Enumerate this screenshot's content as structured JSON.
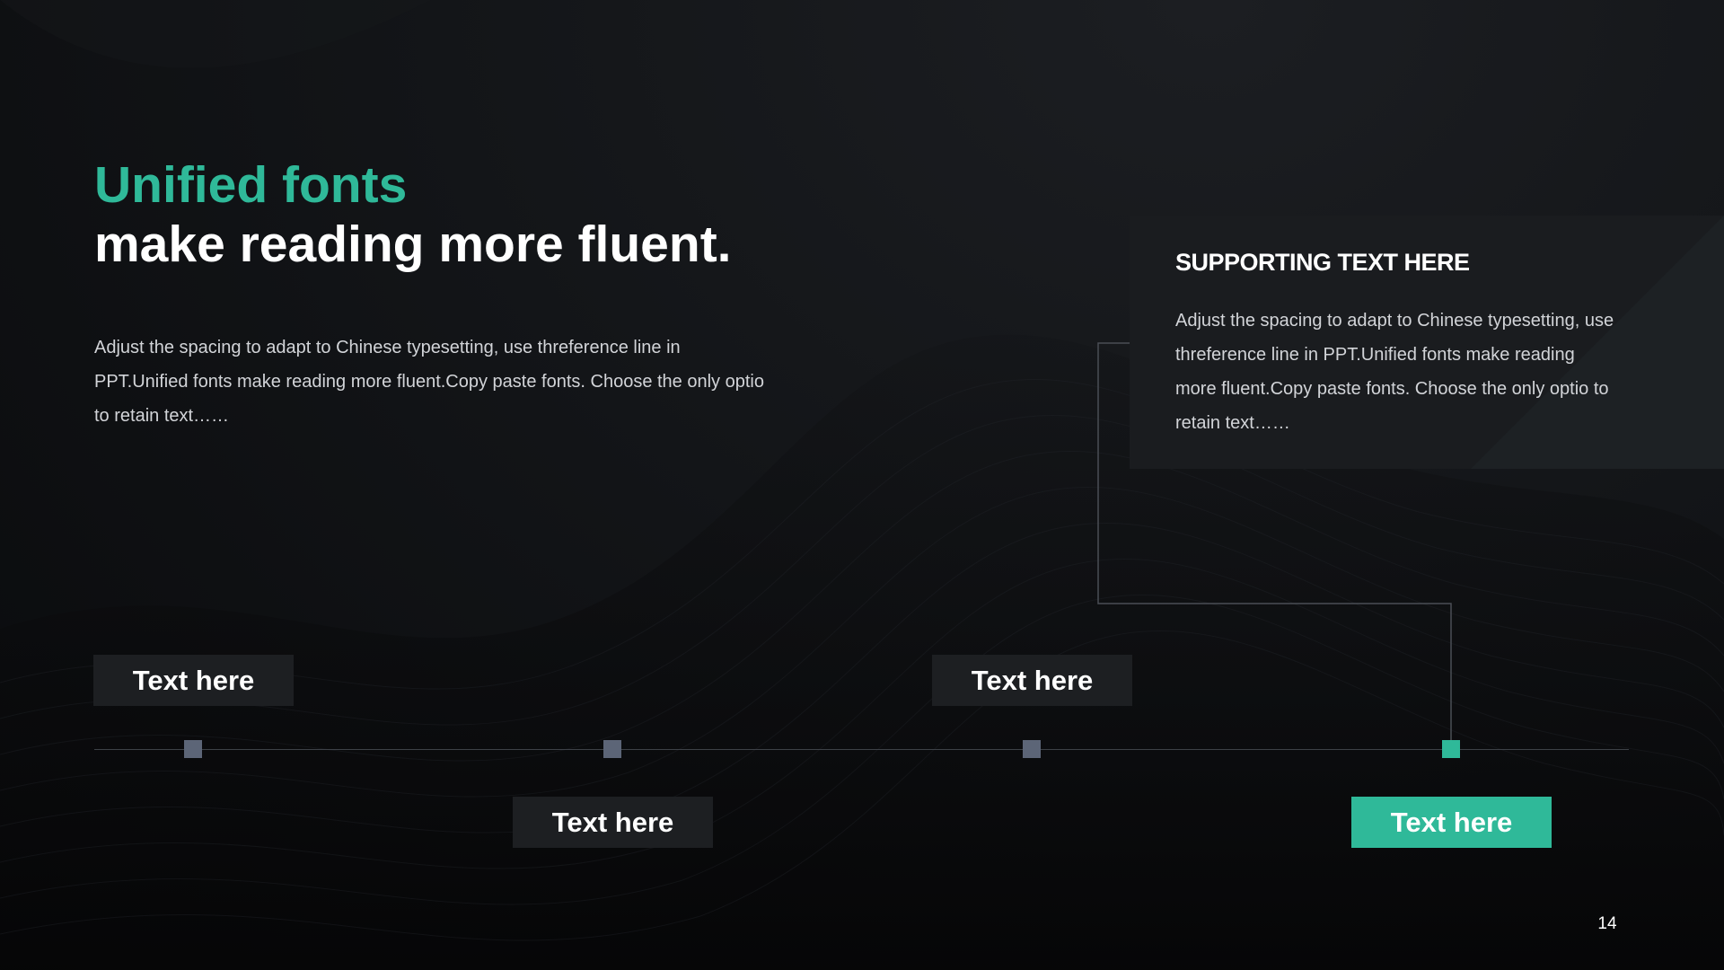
{
  "slide": {
    "title_accent": "Unified fonts",
    "title_main": "make reading more fluent.",
    "intro_text": "Adjust the spacing to adapt to Chinese typesetting, use threference line in PPT.Unified fonts make reading more fluent.Copy paste fonts. Choose the only optio to retain text……",
    "page_number": "14"
  },
  "support": {
    "title": "SUPPORTING TEXT HERE",
    "body": "Adjust the spacing to adapt to Chinese typesetting, use threference line in PPT.Unified fonts make reading more fluent.Copy paste fonts. Choose the only optio to retain text……"
  },
  "timeline": {
    "steps": [
      {
        "label": "Text here",
        "active": false
      },
      {
        "label": "Text here",
        "active": false
      },
      {
        "label": "Text here",
        "active": false
      },
      {
        "label": "Text here",
        "active": true
      }
    ]
  },
  "colors": {
    "accent": "#2fb999",
    "marker": "#5c6577",
    "label_bg": "#1d1f22",
    "panel_bg": "#1a1c1f",
    "text_primary": "#ffffff",
    "text_secondary": "#d2d4d8"
  }
}
